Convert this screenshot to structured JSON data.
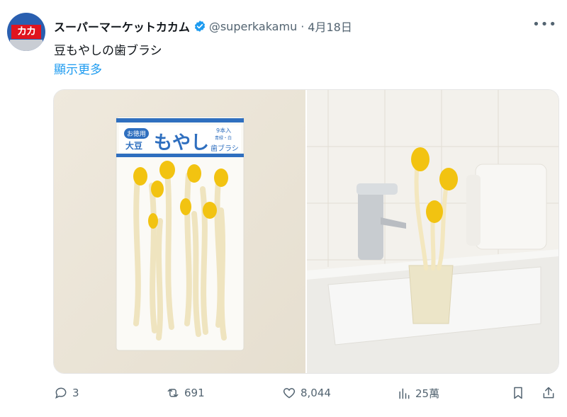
{
  "post": {
    "author_name": "スーパーマーケットカカム",
    "handle": "@superkakamu",
    "separator": "·",
    "date": "4月18日",
    "text": "豆もやしの歯ブラシ",
    "show_more": "顯示更多",
    "avatar_logo_text": "カカ"
  },
  "media": {
    "package": {
      "badge": "お徳用",
      "kind": "大豆",
      "main": "もやし",
      "count": "9本入",
      "color_note": "青緑・白",
      "product": "歯ブラシ"
    }
  },
  "actions": {
    "replies": "3",
    "reposts": "691",
    "likes": "8,044",
    "views": "25萬"
  },
  "colors": {
    "accent": "#1d9bf0",
    "muted": "#536471",
    "brush_yellow": "#f2c311",
    "brush_handle": "#f3e7bf"
  }
}
